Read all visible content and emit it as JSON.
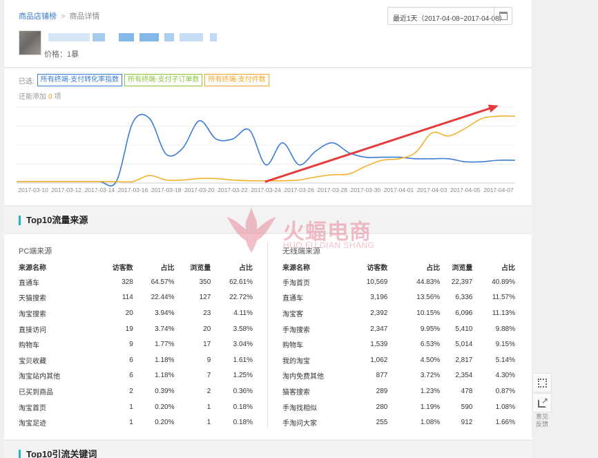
{
  "breadcrumb": {
    "items": [
      "商品店铺榜",
      "商品详情"
    ],
    "separator": ">"
  },
  "date_range": {
    "label": "最近1天（2017-04-08~2017-04-08）",
    "icon": "calendar-icon"
  },
  "product": {
    "price_label": "价格：",
    "price_value": "1",
    "price_suffix": "暴"
  },
  "metrics": {
    "selected_label": "已选:",
    "tags": [
      {
        "label": "所有终端-支付转化率指数",
        "color": "#3a7bd5"
      },
      {
        "label": "所有终端-支付子订单数",
        "color": "#8cc63f"
      },
      {
        "label": "所有终端-支付件数",
        "color": "#f5a623"
      }
    ],
    "add_prefix": "还能添加",
    "add_count": "0",
    "add_suffix": "项"
  },
  "chart_data": {
    "type": "line",
    "x_tick_labels": [
      "2017-03-10",
      "2017-03-12",
      "2017-03-14",
      "2017-03-16",
      "2017-03-18",
      "2017-03-20",
      "2017-03-22",
      "2017-03-24",
      "2017-03-26",
      "2017-03-28",
      "2017-03-30",
      "2017-04-01",
      "2017-04-03",
      "2017-04-05",
      "2017-04-07"
    ],
    "x": [
      "2017-03-09",
      "2017-03-10",
      "2017-03-11",
      "2017-03-12",
      "2017-03-13",
      "2017-03-14",
      "2017-03-15",
      "2017-03-16",
      "2017-03-17",
      "2017-03-18",
      "2017-03-19",
      "2017-03-20",
      "2017-03-21",
      "2017-03-22",
      "2017-03-23",
      "2017-03-24",
      "2017-03-25",
      "2017-03-26",
      "2017-03-27",
      "2017-03-28",
      "2017-03-29",
      "2017-03-30",
      "2017-03-31",
      "2017-04-01",
      "2017-04-02",
      "2017-04-03",
      "2017-04-04",
      "2017-04-05",
      "2017-04-06",
      "2017-04-07",
      "2017-04-08"
    ],
    "series": [
      {
        "color": "#3a7bd5",
        "values": [
          2,
          2,
          2,
          2,
          2,
          2,
          2,
          80,
          85,
          38,
          46,
          82,
          58,
          58,
          70,
          24,
          53,
          24,
          42,
          53,
          40,
          34,
          34,
          34,
          32,
          32,
          32,
          28,
          28,
          30,
          30
        ]
      },
      {
        "color": "#f5b12e",
        "values": [
          2,
          2,
          2,
          2,
          2,
          2,
          2,
          2,
          10,
          4,
          4,
          6,
          6,
          4,
          3,
          3,
          3,
          4,
          8,
          11,
          12,
          22,
          30,
          32,
          40,
          66,
          62,
          72,
          85,
          88,
          88
        ]
      }
    ],
    "ylim": [
      0,
      100
    ],
    "grid": true,
    "annotation": {
      "type": "arrow",
      "color": "#e83a3a",
      "from": [
        "2017-03-24",
        2
      ],
      "to": [
        "2017-04-07",
        102
      ]
    }
  },
  "traffic": {
    "title": "Top10流量来源",
    "pc": {
      "title": "PC端来源",
      "headers": [
        "来源名称",
        "访客数",
        "占比",
        "浏览量",
        "占比"
      ],
      "rows": [
        [
          "直通车",
          "328",
          "64.57%",
          "350",
          "62.61%"
        ],
        [
          "天猫搜索",
          "114",
          "22.44%",
          "127",
          "22.72%"
        ],
        [
          "淘宝搜索",
          "20",
          "3.94%",
          "23",
          "4.11%"
        ],
        [
          "直接访问",
          "19",
          "3.74%",
          "20",
          "3.58%"
        ],
        [
          "购物车",
          "9",
          "1.77%",
          "17",
          "3.04%"
        ],
        [
          "宝贝收藏",
          "6",
          "1.18%",
          "9",
          "1.61%"
        ],
        [
          "淘宝站内其他",
          "6",
          "1.18%",
          "7",
          "1.25%"
        ],
        [
          "已买到商品",
          "2",
          "0.39%",
          "2",
          "0.36%"
        ],
        [
          "淘宝首页",
          "1",
          "0.20%",
          "1",
          "0.18%"
        ],
        [
          "淘宝足迹",
          "1",
          "0.20%",
          "1",
          "0.18%"
        ]
      ]
    },
    "mobile": {
      "title": "无线端来源",
      "headers": [
        "来源名称",
        "访客数",
        "占比",
        "浏览量",
        "占比"
      ],
      "rows": [
        [
          "手淘首页",
          "10,569",
          "44.83%",
          "22,397",
          "40.89%"
        ],
        [
          "直通车",
          "3,196",
          "13.56%",
          "6,336",
          "11.57%"
        ],
        [
          "淘宝客",
          "2,392",
          "10.15%",
          "6,096",
          "11.13%"
        ],
        [
          "手淘搜索",
          "2,347",
          "9.95%",
          "5,410",
          "9.88%"
        ],
        [
          "购物车",
          "1,539",
          "6.53%",
          "5,014",
          "9.15%"
        ],
        [
          "我的淘宝",
          "1,062",
          "4.50%",
          "2,817",
          "5.14%"
        ],
        [
          "淘内免费其他",
          "877",
          "3.72%",
          "2,354",
          "4.30%"
        ],
        [
          "猫客搜索",
          "289",
          "1.23%",
          "478",
          "0.87%"
        ],
        [
          "手淘找相似",
          "280",
          "1.19%",
          "590",
          "1.08%"
        ],
        [
          "手淘问大家",
          "255",
          "1.08%",
          "912",
          "1.66%"
        ]
      ]
    }
  },
  "keywords": {
    "title": "Top10引流关键词"
  },
  "watermark": {
    "main": "火蝠电商",
    "sub": "HUO FU DIAN SHANG"
  },
  "side": {
    "feedback_line1": "意见",
    "feedback_line2": "反馈"
  }
}
